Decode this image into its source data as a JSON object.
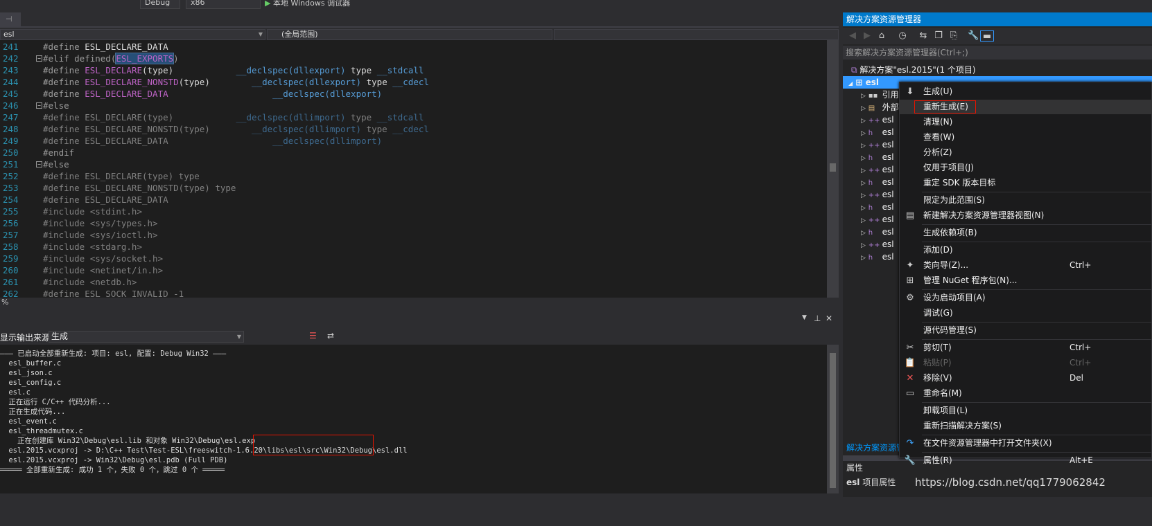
{
  "toolbar": {
    "config": "Debug",
    "platform": "x86",
    "run_label": "本地 Windows 调试器"
  },
  "doctab": {
    "pin": "⊣",
    "close": "✕"
  },
  "nav": {
    "project": "esl",
    "scope": "(全局范围)"
  },
  "editor": {
    "lines": [
      {
        "n": "241",
        "fold": "",
        "seg": [
          [
            "pp",
            "#define "
          ],
          [
            "tx",
            "ESL_DECLARE_DATA"
          ]
        ]
      },
      {
        "n": "242",
        "fold": "−",
        "seg": [
          [
            "pp",
            "#elif defined("
          ],
          [
            "mac sel",
            "ESL_EXPORTS"
          ],
          [
            "pp",
            ")"
          ]
        ]
      },
      {
        "n": "243",
        "fold": "",
        "seg": [
          [
            "pp",
            "#define "
          ],
          [
            "mac",
            "ESL_DECLARE"
          ],
          [
            "tx",
            "(type)            "
          ],
          [
            "kw",
            "__declspec(dllexport)"
          ],
          [
            "tx",
            " type "
          ],
          [
            "kw",
            "__stdcall"
          ]
        ]
      },
      {
        "n": "244",
        "fold": "",
        "seg": [
          [
            "pp",
            "#define "
          ],
          [
            "mac",
            "ESL_DECLARE_NONSTD"
          ],
          [
            "tx",
            "(type)        "
          ],
          [
            "kw",
            "__declspec(dllexport)"
          ],
          [
            "tx",
            " type "
          ],
          [
            "kw",
            "__cdecl"
          ]
        ]
      },
      {
        "n": "245",
        "fold": "",
        "seg": [
          [
            "pp",
            "#define "
          ],
          [
            "mac",
            "ESL_DECLARE_DATA"
          ],
          [
            "tx",
            "                    "
          ],
          [
            "kw",
            "__declspec(dllexport)"
          ]
        ]
      },
      {
        "n": "246",
        "fold": "−",
        "seg": [
          [
            "pp",
            "#else"
          ]
        ]
      },
      {
        "n": "247",
        "fold": "",
        "seg": [
          [
            "dim",
            "#define ESL_DECLARE(type)            "
          ],
          [
            "dimb",
            "__declspec(dllimport)"
          ],
          [
            "dim",
            " type "
          ],
          [
            "dimb",
            "__stdcall"
          ]
        ]
      },
      {
        "n": "248",
        "fold": "",
        "seg": [
          [
            "dim",
            "#define ESL_DECLARE_NONSTD(type)        "
          ],
          [
            "dimb",
            "__declspec(dllimport)"
          ],
          [
            "dim",
            " type "
          ],
          [
            "dimb",
            "__cdecl"
          ]
        ]
      },
      {
        "n": "249",
        "fold": "",
        "seg": [
          [
            "dim",
            "#define ESL_DECLARE_DATA                    "
          ],
          [
            "dimb",
            "__declspec(dllimport)"
          ]
        ]
      },
      {
        "n": "250",
        "fold": "",
        "seg": [
          [
            "pp",
            "#endif"
          ]
        ]
      },
      {
        "n": "251",
        "fold": "−",
        "seg": [
          [
            "pp",
            "#else"
          ]
        ]
      },
      {
        "n": "252",
        "fold": "",
        "seg": [
          [
            "dim",
            "#define ESL_DECLARE(type) type"
          ]
        ]
      },
      {
        "n": "253",
        "fold": "",
        "seg": [
          [
            "dim",
            "#define ESL_DECLARE_NONSTD(type) type"
          ]
        ]
      },
      {
        "n": "254",
        "fold": "",
        "seg": [
          [
            "dim",
            "#define ESL_DECLARE_DATA"
          ]
        ]
      },
      {
        "n": "255",
        "fold": "",
        "seg": [
          [
            "dim",
            "#include <stdint.h>"
          ]
        ]
      },
      {
        "n": "256",
        "fold": "",
        "seg": [
          [
            "dim",
            "#include <sys/types.h>"
          ]
        ]
      },
      {
        "n": "257",
        "fold": "",
        "seg": [
          [
            "dim",
            "#include <sys/ioctl.h>"
          ]
        ]
      },
      {
        "n": "258",
        "fold": "",
        "seg": [
          [
            "dim",
            "#include <stdarg.h>"
          ]
        ]
      },
      {
        "n": "259",
        "fold": "",
        "seg": [
          [
            "dim",
            "#include <sys/socket.h>"
          ]
        ]
      },
      {
        "n": "260",
        "fold": "",
        "seg": [
          [
            "dim",
            "#include <netinet/in.h>"
          ]
        ]
      },
      {
        "n": "261",
        "fold": "",
        "seg": [
          [
            "dim",
            "#include <netdb.h>"
          ]
        ]
      },
      {
        "n": "262",
        "fold": "",
        "seg": [
          [
            "dim",
            "#define ESL_SOCK_INVALID -1"
          ]
        ]
      }
    ]
  },
  "zoom": "%",
  "output": {
    "source_label": "显示输出来源(S):",
    "source_value": "生成",
    "lines": [
      "——— 已启动全部重新生成: 项目: esl, 配置: Debug Win32 ———",
      " esl_buffer.c",
      " esl_json.c",
      " esl_config.c",
      " esl.c",
      " 正在运行 C/C++ 代码分析...",
      " 正在生成代码...",
      " esl_event.c",
      " esl_threadmutex.c",
      "   正在创建库 Win32\\Debug\\esl.lib 和对象 Win32\\Debug\\esl.exp",
      " esl.2015.vcxproj -> D:\\C++ Test\\Test-ESL\\freeswitch-1.6.20\\libs\\esl\\src\\Win32\\Debug\\esl.dll",
      " esl.2015.vcxproj -> Win32\\Debug\\esl.pdb (Full PDB)",
      "═════ 全部重新生成: 成功 1 个，失败 0 个，跳过 0 个 ═════"
    ]
  },
  "solution_explorer": {
    "title": "解决方案资源管理器",
    "search_placeholder": "搜索解决方案资源管理器(Ctrl+;)",
    "solution": "解决方案\"esl.2015\"(1 个项目)",
    "project": "esl",
    "items": [
      "引用",
      "外部",
      "esl",
      "esl",
      "esl",
      "esl",
      "esl",
      "esl",
      "esl",
      "esl",
      "esl",
      "esl",
      "esl",
      "esl"
    ],
    "footer_tab": "解决方案资源管",
    "properties_title": "属性",
    "properties_obj": "esl",
    "properties_sub": "项目属性"
  },
  "context_menu": {
    "items": [
      {
        "label": "生成(U)",
        "icon": "build-icon",
        "glyph": "⬇"
      },
      {
        "label": "重新生成(E)",
        "hl": true
      },
      {
        "label": "清理(N)"
      },
      {
        "label": "查看(W)"
      },
      {
        "label": "分析(Z)"
      },
      {
        "label": "仅用于项目(J)"
      },
      {
        "label": "重定 SDK 版本目标",
        "sep": true
      },
      {
        "label": "限定为此范围(S)"
      },
      {
        "label": "新建解决方案资源管理器视图(N)",
        "icon": "new-view-icon",
        "glyph": "▤",
        "sep": true
      },
      {
        "label": "生成依赖项(B)",
        "sep": true
      },
      {
        "label": "添加(D)"
      },
      {
        "label": "类向导(Z)...",
        "shortcut": "Ctrl+",
        "icon": "class-wizard-icon",
        "glyph": "✦"
      },
      {
        "label": "管理 NuGet 程序包(N)...",
        "icon": "nuget-icon",
        "glyph": "⊞",
        "sep": true
      },
      {
        "label": "设为启动项目(A)",
        "icon": "gear-icon",
        "glyph": "⚙"
      },
      {
        "label": "调试(G)",
        "sep": true
      },
      {
        "label": "源代码管理(S)",
        "sep": true
      },
      {
        "label": "剪切(T)",
        "shortcut": "Ctrl+",
        "icon": "scissors-icon",
        "glyph": "✂"
      },
      {
        "label": "粘贴(P)",
        "shortcut": "Ctrl+",
        "disabled": true,
        "icon": "paste-icon",
        "glyph": "📋"
      },
      {
        "label": "移除(V)",
        "shortcut": "Del",
        "icon": "remove-icon",
        "glyph": "✕",
        "color": "#f25757"
      },
      {
        "label": "重命名(M)",
        "icon": "rename-icon",
        "glyph": "▭",
        "sep": true
      },
      {
        "label": "卸载项目(L)"
      },
      {
        "label": "重新扫描解决方案(S)",
        "sep": true
      },
      {
        "label": "在文件资源管理器中打开文件夹(X)",
        "icon": "open-folder-icon",
        "glyph": "↷",
        "color": "#3ea6ff",
        "sep": true
      },
      {
        "label": "属性(R)",
        "shortcut": "Alt+E",
        "icon": "wrench-icon",
        "glyph": "🔧"
      }
    ]
  },
  "watermark": "https://blog.csdn.net/qq1779062842",
  "colors": {
    "accent": "#007acc",
    "highlight_box": "#e51400"
  }
}
